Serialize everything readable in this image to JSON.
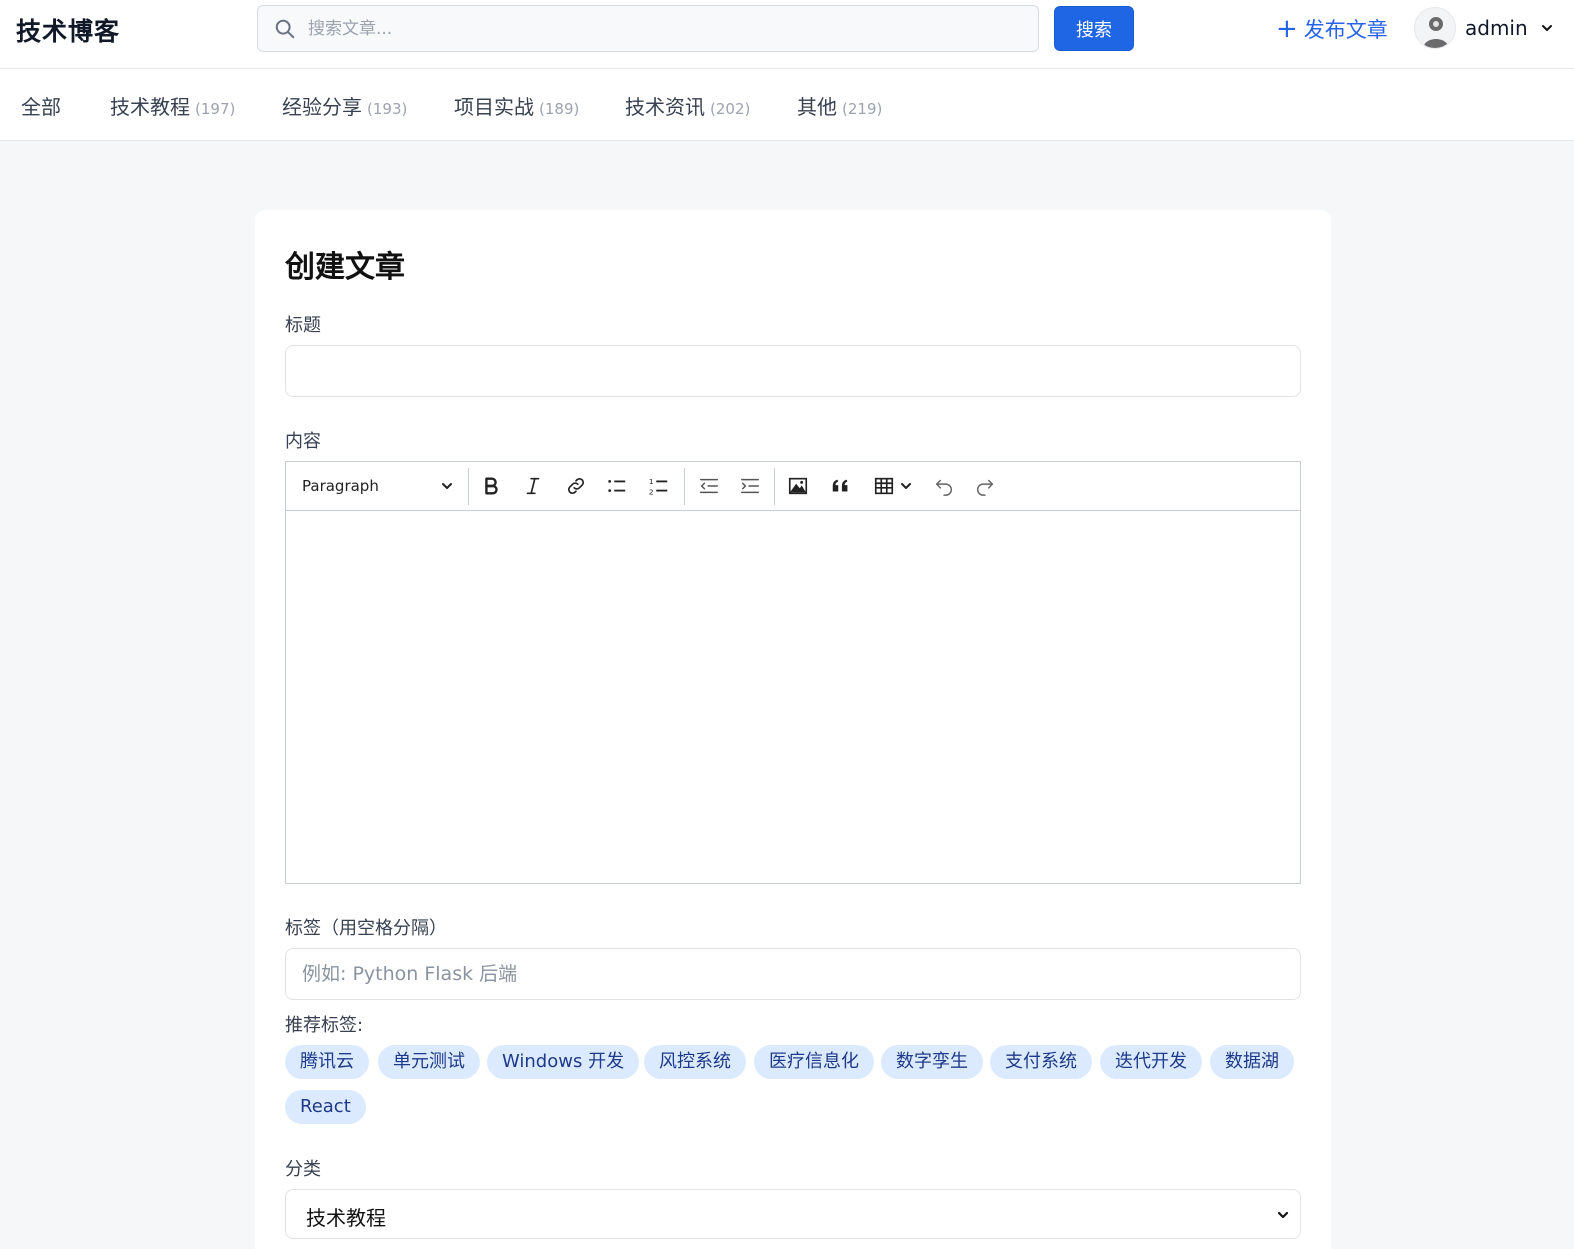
{
  "header": {
    "brand": "技术博客",
    "search_placeholder": "搜索文章...",
    "search_button": "搜索",
    "publish_label": "发布文章",
    "user_name": "admin"
  },
  "categories": [
    {
      "label": "全部",
      "count": ""
    },
    {
      "label": "技术教程",
      "count": "(197)"
    },
    {
      "label": "经验分享",
      "count": "(193)"
    },
    {
      "label": "项目实战",
      "count": "(189)"
    },
    {
      "label": "技术资讯",
      "count": "(202)"
    },
    {
      "label": "其他",
      "count": "(219)"
    }
  ],
  "form": {
    "page_title": "创建文章",
    "title_label": "标题",
    "title_value": "",
    "content_label": "内容",
    "editor_block_style": "Paragraph",
    "tags_label": "标签（用空格分隔）",
    "tags_placeholder": "例如: Python Flask 后端",
    "suggested_label": "推荐标签:",
    "suggested_tags": [
      "腾讯云",
      "单元测试",
      "Windows 开发",
      "风控系统",
      "医疗信息化",
      "数字孪生",
      "支付系统",
      "迭代开发",
      "数据湖",
      "React"
    ],
    "category_label": "分类",
    "category_value": "技术教程"
  },
  "toolbar_icons": [
    "bold-icon",
    "italic-icon",
    "link-icon",
    "bulleted-list-icon",
    "numbered-list-icon",
    "outdent-icon",
    "indent-icon",
    "image-icon",
    "blockquote-icon",
    "table-icon",
    "undo-icon",
    "redo-icon"
  ],
  "colors": {
    "accent": "#1f66e5",
    "link": "#2563eb",
    "tag_bg": "#dbeafe",
    "tag_text": "#1e3a8a"
  }
}
